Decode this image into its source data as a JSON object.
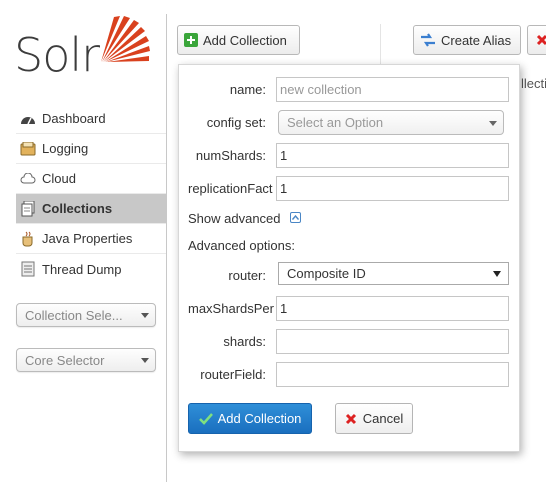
{
  "logo": {
    "text": "Solr"
  },
  "sidebar": {
    "items": [
      {
        "label": "Dashboard",
        "icon": "dashboard-icon"
      },
      {
        "label": "Logging",
        "icon": "logging-icon"
      },
      {
        "label": "Cloud",
        "icon": "cloud-icon"
      },
      {
        "label": "Collections",
        "icon": "collections-icon",
        "active": true
      },
      {
        "label": "Java Properties",
        "icon": "java-properties-icon"
      },
      {
        "label": "Thread Dump",
        "icon": "thread-dump-icon"
      }
    ],
    "collection_selector": "Collection Sele...",
    "core_selector": "Core Selector"
  },
  "toolbar": {
    "add_collection": "Add Collection",
    "create_alias": "Create Alias",
    "overflow_text": "llectio"
  },
  "form": {
    "name_label": "name:",
    "name_placeholder": "new collection",
    "config_set_label": "config set:",
    "config_set_placeholder": "Select an Option",
    "num_shards_label": "numShards:",
    "num_shards_value": "1",
    "replication_label": "replicationFact",
    "replication_value": "1",
    "show_advanced": "Show advanced",
    "advanced_options": "Advanced options:",
    "router_label": "router:",
    "router_value": "Composite ID",
    "max_shards_label": "maxShardsPer",
    "max_shards_value": "1",
    "shards_label": "shards:",
    "shards_value": "",
    "router_field_label": "routerField:",
    "router_field_value": "",
    "submit_label": "Add Collection",
    "cancel_label": "Cancel"
  },
  "colors": {
    "brand_red": "#d9411e",
    "primary_blue": "#1a6fbf",
    "active_nav": "#c8c8c8"
  }
}
